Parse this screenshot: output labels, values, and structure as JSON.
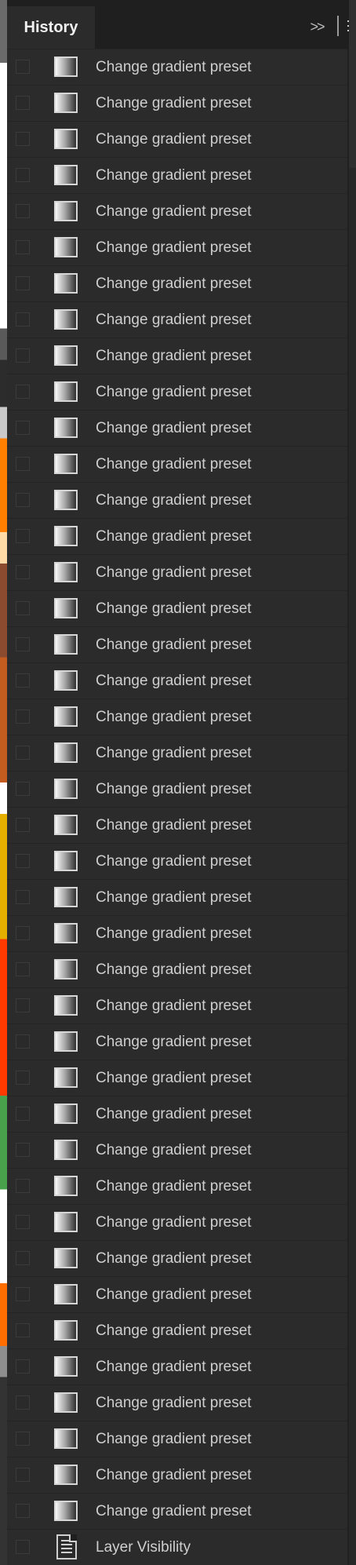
{
  "panel": {
    "tab_label": "History",
    "collapse_glyph": ">>"
  },
  "history": {
    "items": [
      {
        "label": "Change gradient preset",
        "icon": "gradient-icon"
      },
      {
        "label": "Change gradient preset",
        "icon": "gradient-icon"
      },
      {
        "label": "Change gradient preset",
        "icon": "gradient-icon"
      },
      {
        "label": "Change gradient preset",
        "icon": "gradient-icon"
      },
      {
        "label": "Change gradient preset",
        "icon": "gradient-icon"
      },
      {
        "label": "Change gradient preset",
        "icon": "gradient-icon"
      },
      {
        "label": "Change gradient preset",
        "icon": "gradient-icon"
      },
      {
        "label": "Change gradient preset",
        "icon": "gradient-icon"
      },
      {
        "label": "Change gradient preset",
        "icon": "gradient-icon"
      },
      {
        "label": "Change gradient preset",
        "icon": "gradient-icon"
      },
      {
        "label": "Change gradient preset",
        "icon": "gradient-icon"
      },
      {
        "label": "Change gradient preset",
        "icon": "gradient-icon"
      },
      {
        "label": "Change gradient preset",
        "icon": "gradient-icon"
      },
      {
        "label": "Change gradient preset",
        "icon": "gradient-icon"
      },
      {
        "label": "Change gradient preset",
        "icon": "gradient-icon"
      },
      {
        "label": "Change gradient preset",
        "icon": "gradient-icon"
      },
      {
        "label": "Change gradient preset",
        "icon": "gradient-icon"
      },
      {
        "label": "Change gradient preset",
        "icon": "gradient-icon"
      },
      {
        "label": "Change gradient preset",
        "icon": "gradient-icon"
      },
      {
        "label": "Change gradient preset",
        "icon": "gradient-icon"
      },
      {
        "label": "Change gradient preset",
        "icon": "gradient-icon"
      },
      {
        "label": "Change gradient preset",
        "icon": "gradient-icon"
      },
      {
        "label": "Change gradient preset",
        "icon": "gradient-icon"
      },
      {
        "label": "Change gradient preset",
        "icon": "gradient-icon"
      },
      {
        "label": "Change gradient preset",
        "icon": "gradient-icon"
      },
      {
        "label": "Change gradient preset",
        "icon": "gradient-icon"
      },
      {
        "label": "Change gradient preset",
        "icon": "gradient-icon"
      },
      {
        "label": "Change gradient preset",
        "icon": "gradient-icon"
      },
      {
        "label": "Change gradient preset",
        "icon": "gradient-icon"
      },
      {
        "label": "Change gradient preset",
        "icon": "gradient-icon"
      },
      {
        "label": "Change gradient preset",
        "icon": "gradient-icon"
      },
      {
        "label": "Change gradient preset",
        "icon": "gradient-icon"
      },
      {
        "label": "Change gradient preset",
        "icon": "gradient-icon"
      },
      {
        "label": "Change gradient preset",
        "icon": "gradient-icon"
      },
      {
        "label": "Change gradient preset",
        "icon": "gradient-icon"
      },
      {
        "label": "Change gradient preset",
        "icon": "gradient-icon"
      },
      {
        "label": "Change gradient preset",
        "icon": "gradient-icon"
      },
      {
        "label": "Change gradient preset",
        "icon": "gradient-icon"
      },
      {
        "label": "Change gradient preset",
        "icon": "gradient-icon"
      },
      {
        "label": "Change gradient preset",
        "icon": "gradient-icon"
      },
      {
        "label": "Change gradient preset",
        "icon": "gradient-icon"
      },
      {
        "label": "Layer Visibility",
        "icon": "document-icon"
      }
    ]
  },
  "colors": {
    "panel_bg": "#2b2b2b",
    "tabbar_bg": "#1f1f1f",
    "text": "#cfcfcf",
    "tab_text": "#f0f0f0"
  }
}
